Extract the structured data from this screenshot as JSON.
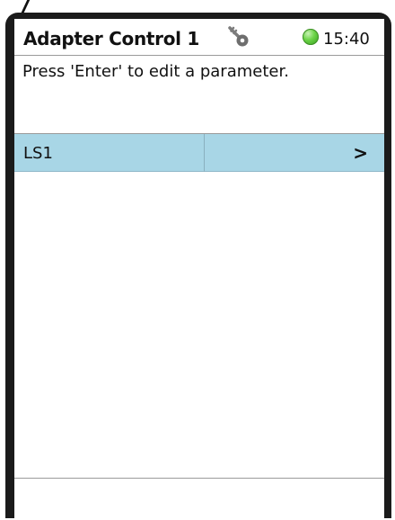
{
  "header": {
    "title": "Adapter Control 1",
    "time": "15:40",
    "lock_icon": "key-icon",
    "status_icon": "status-led-green",
    "status_color": "#5cc83a"
  },
  "instruction": {
    "text": "Press 'Enter' to edit a parameter."
  },
  "list": {
    "selected_color": "#a8d6e6",
    "items": [
      {
        "label": "LS1",
        "value": "",
        "arrow": ">"
      }
    ]
  }
}
